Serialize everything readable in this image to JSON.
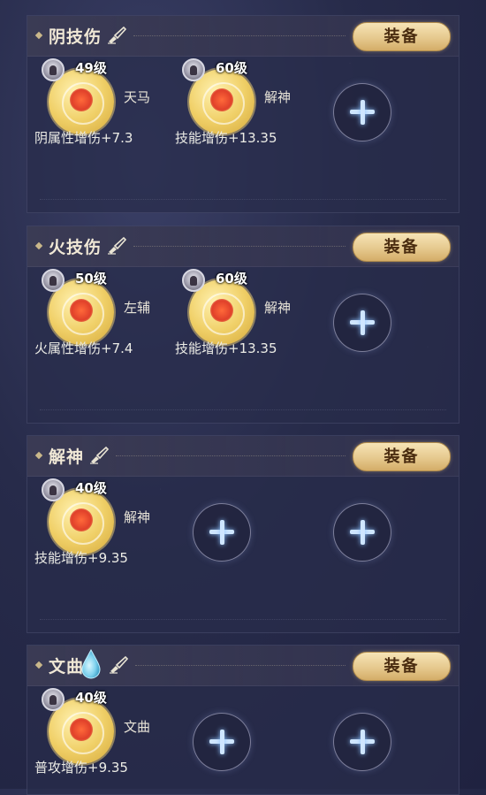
{
  "colors": {
    "equip_button": "#e6c98e",
    "coin_gold": "#f0d068",
    "panel_bg": "#2c2f4f",
    "plus_glow": "#cfe6ff"
  },
  "icons": {
    "section_marker": "diamond-icon",
    "edit": "brush-edit-icon",
    "add": "plus-icon",
    "gem": "water-drop-icon"
  },
  "sections": [
    {
      "title": "阴技伤",
      "equip_label": "装备",
      "slots": [
        {
          "level": "49级",
          "name": "天马",
          "stat": "阴属性增伤+7.3"
        },
        {
          "level": "60级",
          "name": "解神",
          "stat": "技能增伤+13.35"
        }
      ]
    },
    {
      "title": "火技伤",
      "equip_label": "装备",
      "slots": [
        {
          "level": "50级",
          "name": "左辅",
          "stat": "火属性增伤+7.4"
        },
        {
          "level": "60级",
          "name": "解神",
          "stat": "技能增伤+13.35"
        }
      ]
    },
    {
      "title": "解神",
      "equip_label": "装备",
      "slots": [
        {
          "level": "40级",
          "name": "解神",
          "stat": "技能增伤+9.35"
        }
      ]
    },
    {
      "title": "文曲",
      "equip_label": "装备",
      "slots": [
        {
          "level": "40级",
          "name": "文曲",
          "stat": "普攻增伤+9.35"
        }
      ]
    }
  ]
}
